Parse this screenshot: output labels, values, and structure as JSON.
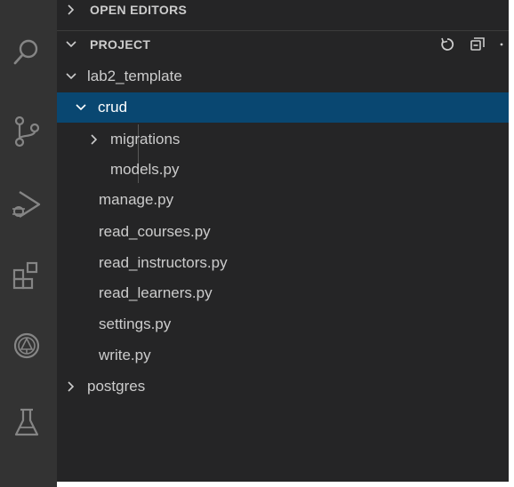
{
  "activity_bar": {
    "icons": [
      "search-icon",
      "source-control-icon",
      "run-debug-icon",
      "extensions-icon",
      "remote-explorer-icon",
      "testing-icon"
    ]
  },
  "explorer": {
    "open_editors": {
      "label": "OPEN EDITORS",
      "expanded": false
    },
    "project": {
      "label": "PROJECT",
      "expanded": true,
      "actions": [
        "refresh-icon",
        "collapse-all-icon"
      ]
    },
    "tree": {
      "root": {
        "label": "lab2_template",
        "expanded": true
      },
      "crud": {
        "label": "crud",
        "expanded": true,
        "selected": true
      },
      "migrations": {
        "label": "migrations",
        "expanded": false
      },
      "models": {
        "label": "models.py"
      },
      "files": [
        "manage.py",
        "read_courses.py",
        "read_instructors.py",
        "read_learners.py",
        "settings.py",
        "write.py"
      ],
      "postgres": {
        "label": "postgres",
        "expanded": false
      }
    }
  },
  "colors": {
    "activity_bar_bg": "#333333",
    "sidebar_bg": "#252526",
    "selection_bg": "#094771",
    "text": "#cccccc",
    "icon": "#858585"
  }
}
